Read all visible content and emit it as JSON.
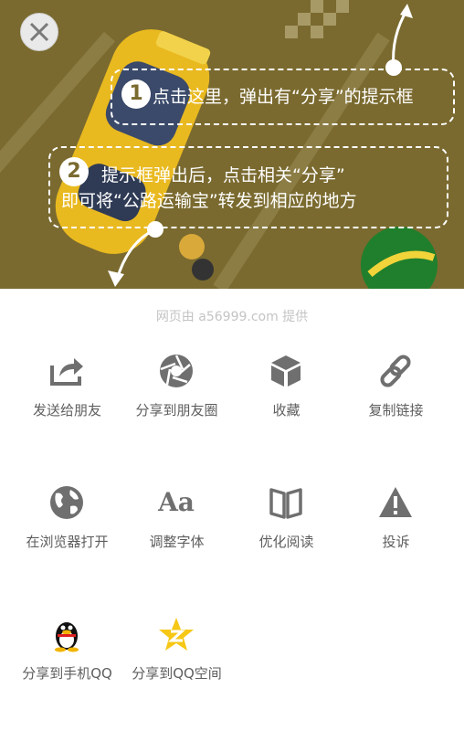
{
  "overlay": {
    "close_icon": "close-icon",
    "tip1": {
      "number": "1",
      "text": "点击这里，弹出有“分享”的提示框"
    },
    "tip2": {
      "number": "2",
      "line1": "提示框弹出后，点击相关“分享”",
      "line2": "即可将“公路运输宝”转发到相应的地方"
    }
  },
  "sheet": {
    "credit": "网页由 a56999.com 提供",
    "items": [
      {
        "label": "发送给朋友",
        "icon": "share-arrow-icon"
      },
      {
        "label": "分享到朋友圈",
        "icon": "aperture-icon"
      },
      {
        "label": "收藏",
        "icon": "cube-icon"
      },
      {
        "label": "复制链接",
        "icon": "link-icon"
      },
      {
        "label": "在浏览器打开",
        "icon": "globe-icon"
      },
      {
        "label": "调整字体",
        "icon": "font-icon",
        "glyph": "Aa"
      },
      {
        "label": "优化阅读",
        "icon": "book-icon"
      },
      {
        "label": "投诉",
        "icon": "warning-icon"
      },
      {
        "label": "分享到手机QQ",
        "icon": "qq-penguin-icon"
      },
      {
        "label": "分享到QQ空间",
        "icon": "qzone-star-icon"
      }
    ]
  },
  "colors": {
    "overlay_bg": "#7a6a2f",
    "icon_gray": "#6f6f6f",
    "label_gray": "#5e5e5e",
    "qzone_yellow": "#f6c715"
  }
}
